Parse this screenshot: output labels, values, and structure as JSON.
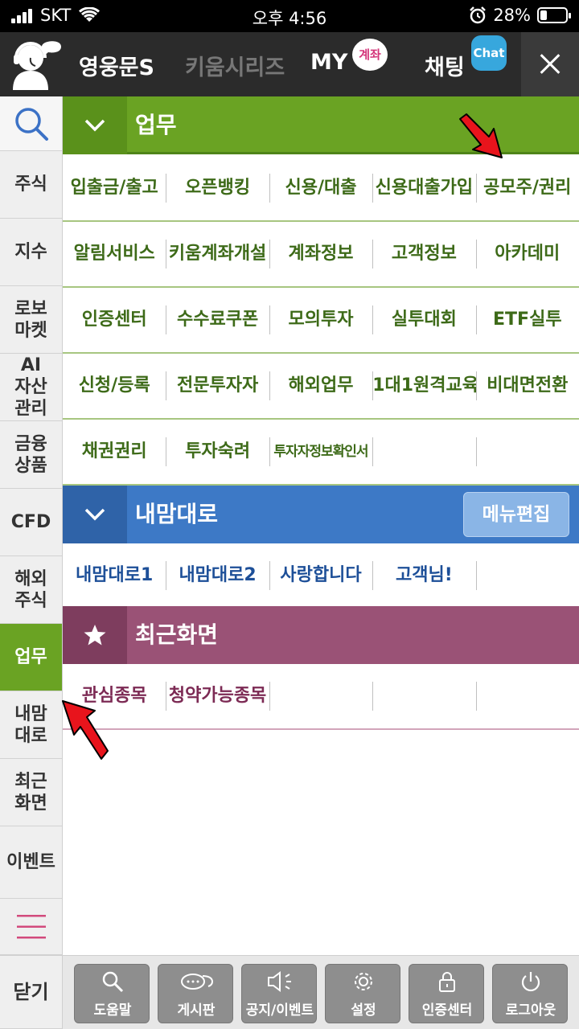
{
  "status": {
    "carrier": "SKT",
    "time": "오후 4:56",
    "battery": "28%",
    "battery_level": 0.28
  },
  "header": {
    "tabs": [
      "영웅문S",
      "키움시리즈",
      "MY",
      "채팅"
    ],
    "my_badge": "계좌",
    "chat_badge": "Chat"
  },
  "sidebar": {
    "items": [
      "주식",
      "지수",
      "로보\n마켓",
      "AI\n자산\n관리",
      "금융\n상품",
      "CFD",
      "해외\n주식",
      "업무",
      "내맘\n대로",
      "최근\n화면",
      "이벤트"
    ],
    "active": "업무",
    "close_label": "닫기"
  },
  "sections": {
    "work": {
      "title": "업무",
      "rows": [
        [
          "입출금/출고",
          "오픈뱅킹",
          "신용/대출",
          "신용대출가입",
          "공모주/권리"
        ],
        [
          "알림서비스",
          "키움계좌개설",
          "계좌정보",
          "고객정보",
          "아카데미"
        ],
        [
          "인증센터",
          "수수료쿠폰",
          "모의투자",
          "실투대회",
          "ETF실투"
        ],
        [
          "신청/등록",
          "전문투자자",
          "해외업무",
          "1대1원격교육",
          "비대면전환"
        ],
        [
          "채권권리",
          "투자숙려",
          "투자자정보확인서",
          "",
          ""
        ]
      ]
    },
    "custom": {
      "title": "내맘대로",
      "edit_label": "메뉴편집",
      "rows": [
        [
          "내맘대로1",
          "내맘대로2",
          "사랑합니다",
          "고객님!",
          ""
        ]
      ]
    },
    "recent": {
      "title": "최근화면",
      "rows": [
        [
          "관심종목",
          "청약가능종목",
          "",
          "",
          ""
        ]
      ]
    }
  },
  "toolbar": {
    "buttons": [
      {
        "label": "도움말",
        "icon": "magnifier-icon"
      },
      {
        "label": "게시판",
        "icon": "chat-bubbles-icon"
      },
      {
        "label": "공지/이벤트",
        "icon": "speaker-icon"
      },
      {
        "label": "설정",
        "icon": "gear-icon"
      },
      {
        "label": "인증센터",
        "icon": "lock-icon"
      },
      {
        "label": "로그아웃",
        "icon": "power-icon"
      }
    ]
  },
  "colors": {
    "work_accent": "#6aa323",
    "custom_accent": "#3d79c6",
    "recent_accent": "#9a5276",
    "header_bg": "#2b2b2b"
  }
}
